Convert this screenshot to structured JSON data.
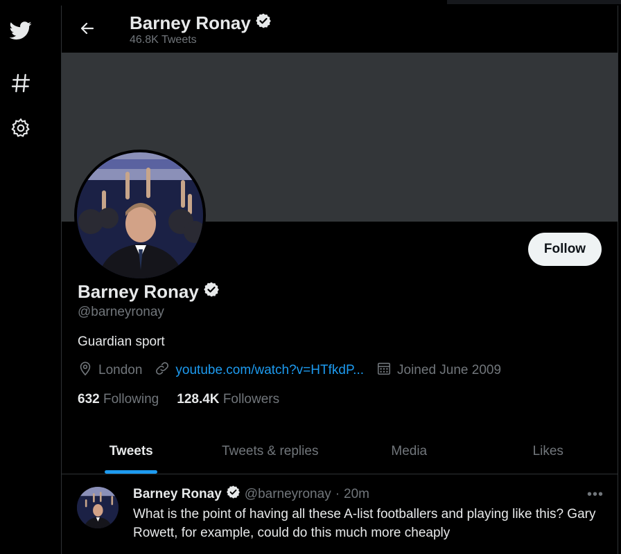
{
  "nav": {
    "items": [
      {
        "icon": "twitter-bird-icon"
      },
      {
        "icon": "hashtag-icon"
      },
      {
        "icon": "gear-icon"
      }
    ]
  },
  "header": {
    "name": "Barney Ronay",
    "tweet_count": "46.8K Tweets"
  },
  "profile": {
    "name": "Barney Ronay",
    "handle": "@barneyronay",
    "bio": "Guardian sport",
    "location": "London",
    "link": "youtube.com/watch?v=HTfkdP...",
    "joined": "Joined June 2009",
    "following_count": "632",
    "following_label": "Following",
    "followers_count": "128.4K",
    "followers_label": "Followers",
    "follow_label": "Follow",
    "verified": true
  },
  "tabs": [
    {
      "label": "Tweets",
      "active": true
    },
    {
      "label": "Tweets & replies",
      "active": false
    },
    {
      "label": "Media",
      "active": false
    },
    {
      "label": "Likes",
      "active": false
    }
  ],
  "tweet": {
    "name": "Barney Ronay",
    "handle": "@barneyronay",
    "separator": "·",
    "time": "20m",
    "text": "What is the point of having all these A-list footballers and playing like this? Gary Rowett, for example, could do this much more cheaply",
    "more": "•••"
  },
  "colors": {
    "background": "#000000",
    "banner": "#333639",
    "accent": "#1d9bf0",
    "secondary_text": "#71767b"
  }
}
